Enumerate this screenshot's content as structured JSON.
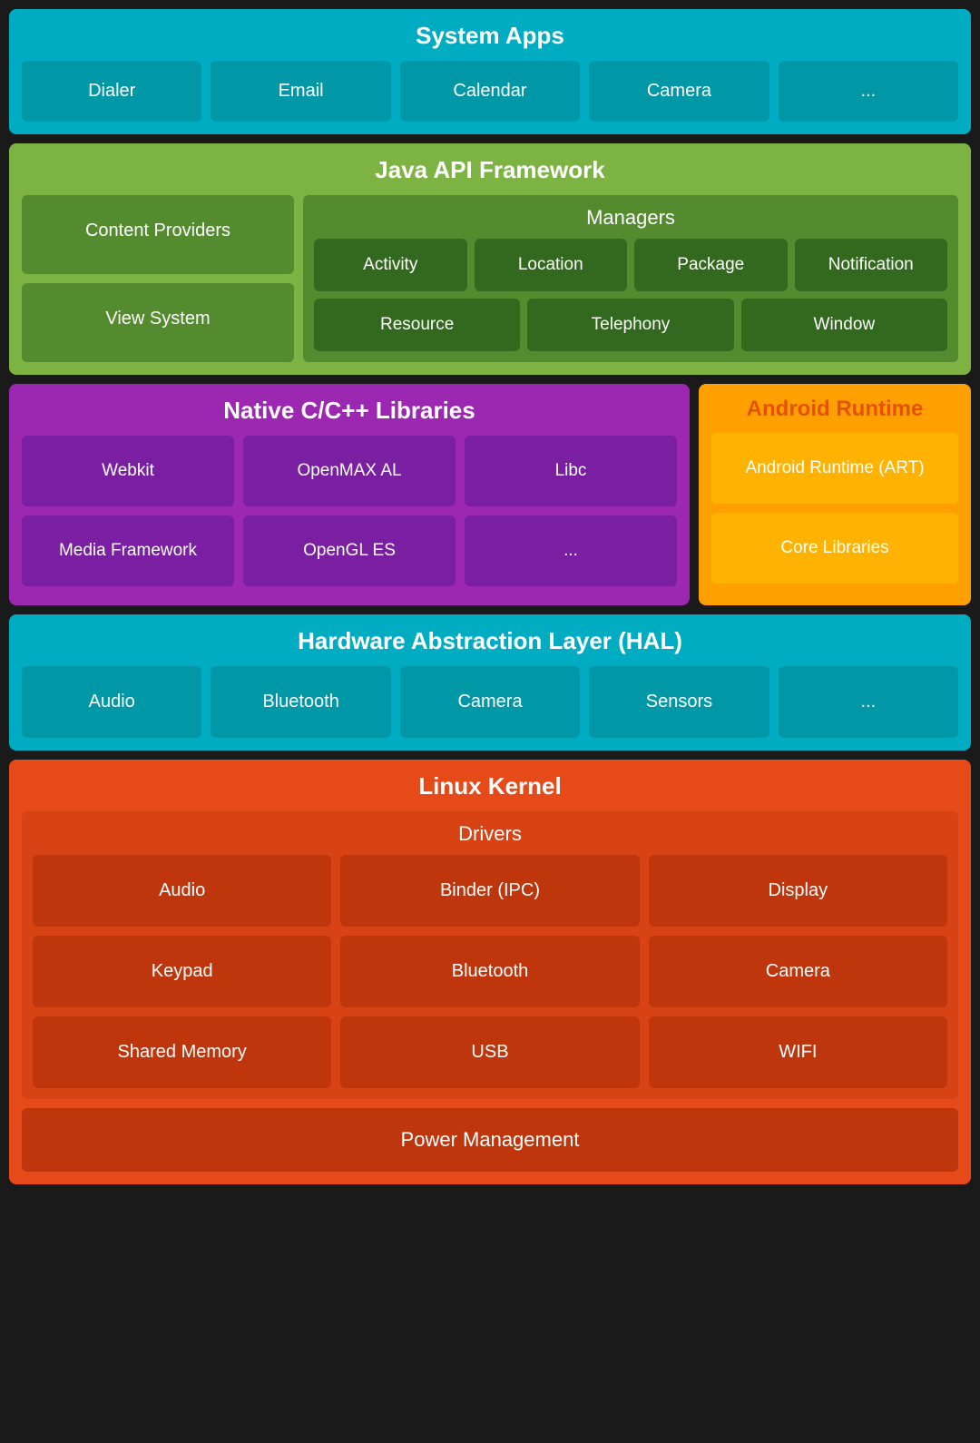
{
  "system_apps": {
    "title": "System Apps",
    "apps": [
      "Dialer",
      "Email",
      "Calendar",
      "Camera",
      "..."
    ]
  },
  "java_api": {
    "title": "Java API Framework",
    "left": {
      "content_providers": "Content Providers",
      "view_system": "View System"
    },
    "managers": {
      "title": "Managers",
      "row1": [
        "Activity",
        "Location",
        "Package",
        "Notification"
      ],
      "row2": [
        "Resource",
        "Telephony",
        "Window"
      ]
    }
  },
  "native_libs": {
    "title": "Native C/C++ Libraries",
    "items": [
      "Webkit",
      "OpenMAX AL",
      "Libc",
      "Media Framework",
      "OpenGL ES",
      "..."
    ]
  },
  "android_runtime": {
    "title": "Android Runtime",
    "art": "Android Runtime (ART)",
    "core": "Core Libraries"
  },
  "hal": {
    "title": "Hardware Abstraction Layer (HAL)",
    "items": [
      "Audio",
      "Bluetooth",
      "Camera",
      "Sensors",
      "..."
    ]
  },
  "linux_kernel": {
    "title": "Linux Kernel",
    "drivers_title": "Drivers",
    "drivers": [
      "Audio",
      "Binder (IPC)",
      "Display",
      "Keypad",
      "Bluetooth",
      "Camera",
      "Shared Memory",
      "USB",
      "WIFI"
    ],
    "power_management": "Power Management"
  }
}
